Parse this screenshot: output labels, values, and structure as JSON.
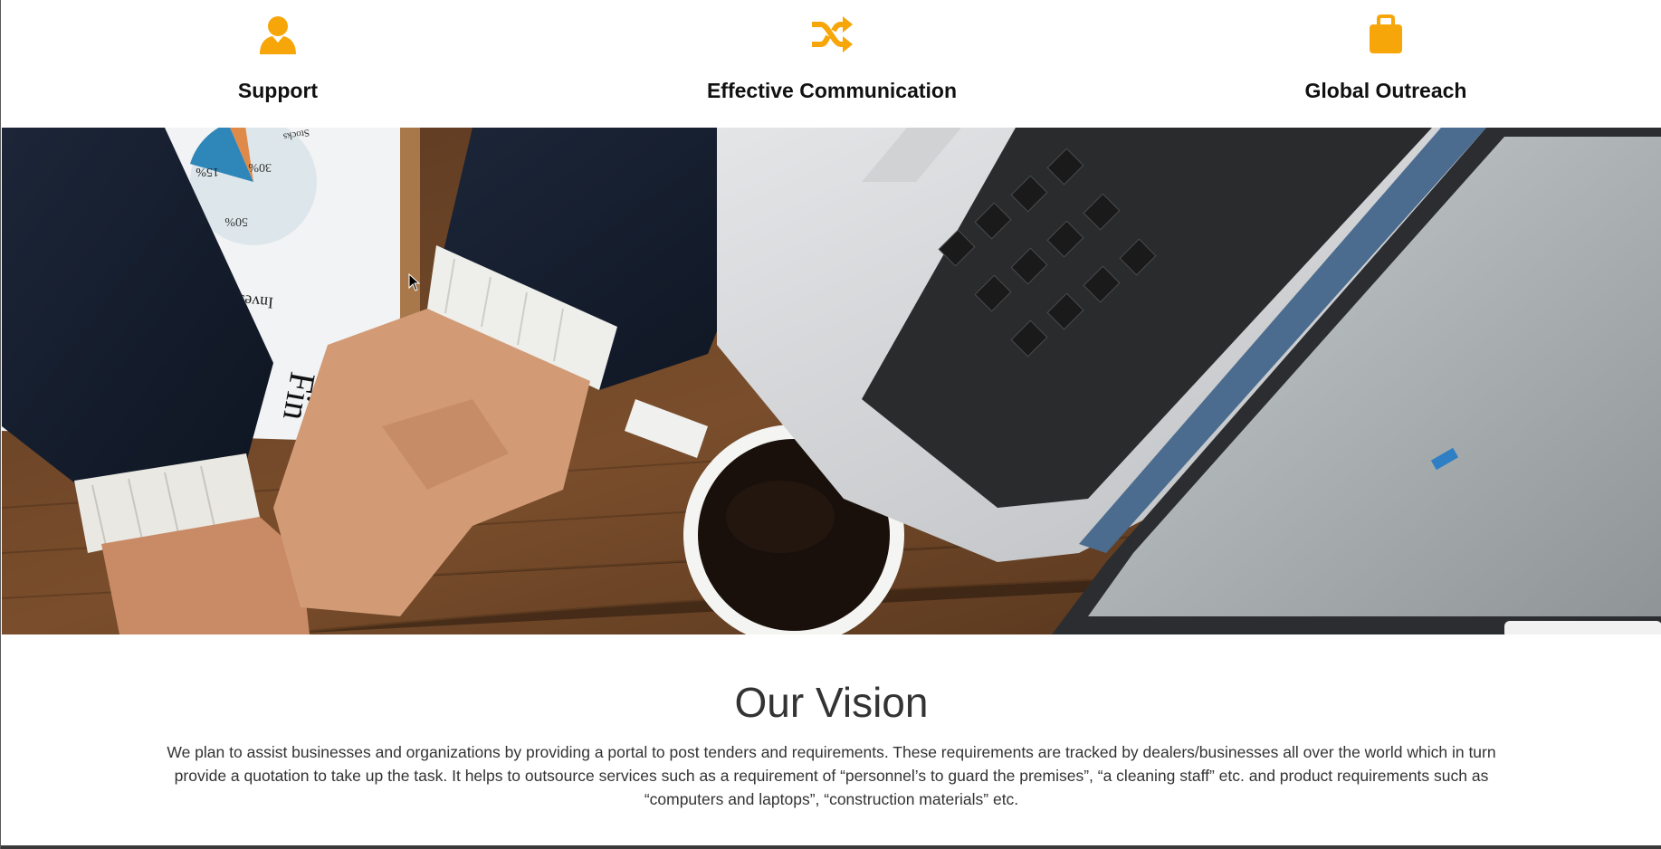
{
  "features": [
    {
      "icon": "user-icon",
      "title": "Support"
    },
    {
      "icon": "shuffle-icon",
      "title": "Effective Communication"
    },
    {
      "icon": "briefcase-icon",
      "title": "Global Outreach"
    }
  ],
  "hero": {
    "image": "business-desk-laptop-coffee-photo",
    "document_chart_labels": [
      "15%",
      "30%",
      "50%",
      "Stocks"
    ],
    "document_text": [
      "Investment",
      "Fin"
    ]
  },
  "vision": {
    "title": "Our Vision",
    "text": "We plan to assist businesses and organizations by providing a portal to post tenders and requirements. These requirements are tracked by dealers/businesses all over the world which in turn provide a quotation to take up the task. It helps to outsource services such as a requirement of “personnel’s to guard the premises”, “a cleaning staff” etc. and product requirements such as “computers and laptops”, “construction materials” etc."
  },
  "colors": {
    "accent": "#f6a609",
    "heading": "#111111",
    "body_text": "#333333",
    "footer_bar": "#3a3a3a"
  }
}
